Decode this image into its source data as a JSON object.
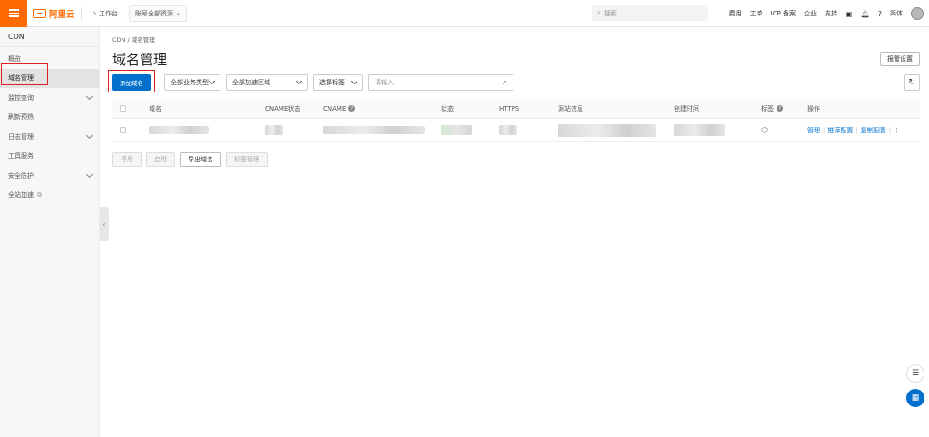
{
  "topbar": {
    "brand": "阿里云",
    "workbench": "工作台",
    "account_scope": "账号全部资源",
    "search_placeholder": "搜索...",
    "links": [
      "费用",
      "工单",
      "ICP 备案",
      "企业",
      "支持"
    ],
    "language": "简体"
  },
  "sidebar": {
    "title": "CDN",
    "items": [
      {
        "label": "概览",
        "expandable": false,
        "active": false
      },
      {
        "label": "域名管理",
        "expandable": false,
        "active": true
      },
      {
        "label": "监控查询",
        "expandable": true,
        "active": false
      },
      {
        "label": "刷新预热",
        "expandable": false,
        "active": false
      },
      {
        "label": "日志管理",
        "expandable": true,
        "active": false
      },
      {
        "label": "工具服务",
        "expandable": false,
        "active": false
      },
      {
        "label": "安全防护",
        "expandable": true,
        "active": false
      },
      {
        "label": "全站加速",
        "expandable": false,
        "active": false
      }
    ]
  },
  "main": {
    "breadcrumb": "CDN  /  域名管理",
    "title": "域名管理",
    "alarm_button": "报警设置",
    "add_domain_button": "添加域名",
    "filters": {
      "business_type": "全部业务类型",
      "region": "全部加速区域",
      "tag": "选择标签",
      "search_placeholder": "请输入"
    },
    "table": {
      "columns": [
        "域名",
        "CNAME状态",
        "CNAME",
        "状态",
        "HTTPS",
        "源站信息",
        "创建时间",
        "标签",
        "操作"
      ],
      "row_actions": [
        "管理",
        "推荐配置",
        "复制配置"
      ]
    },
    "bottom_actions": [
      "停用",
      "启用",
      "导出域名",
      "标签管理"
    ]
  },
  "colors": {
    "brand_orange": "#ff6a00",
    "primary_blue": "#0070cc",
    "highlight_red": "#e02020"
  }
}
